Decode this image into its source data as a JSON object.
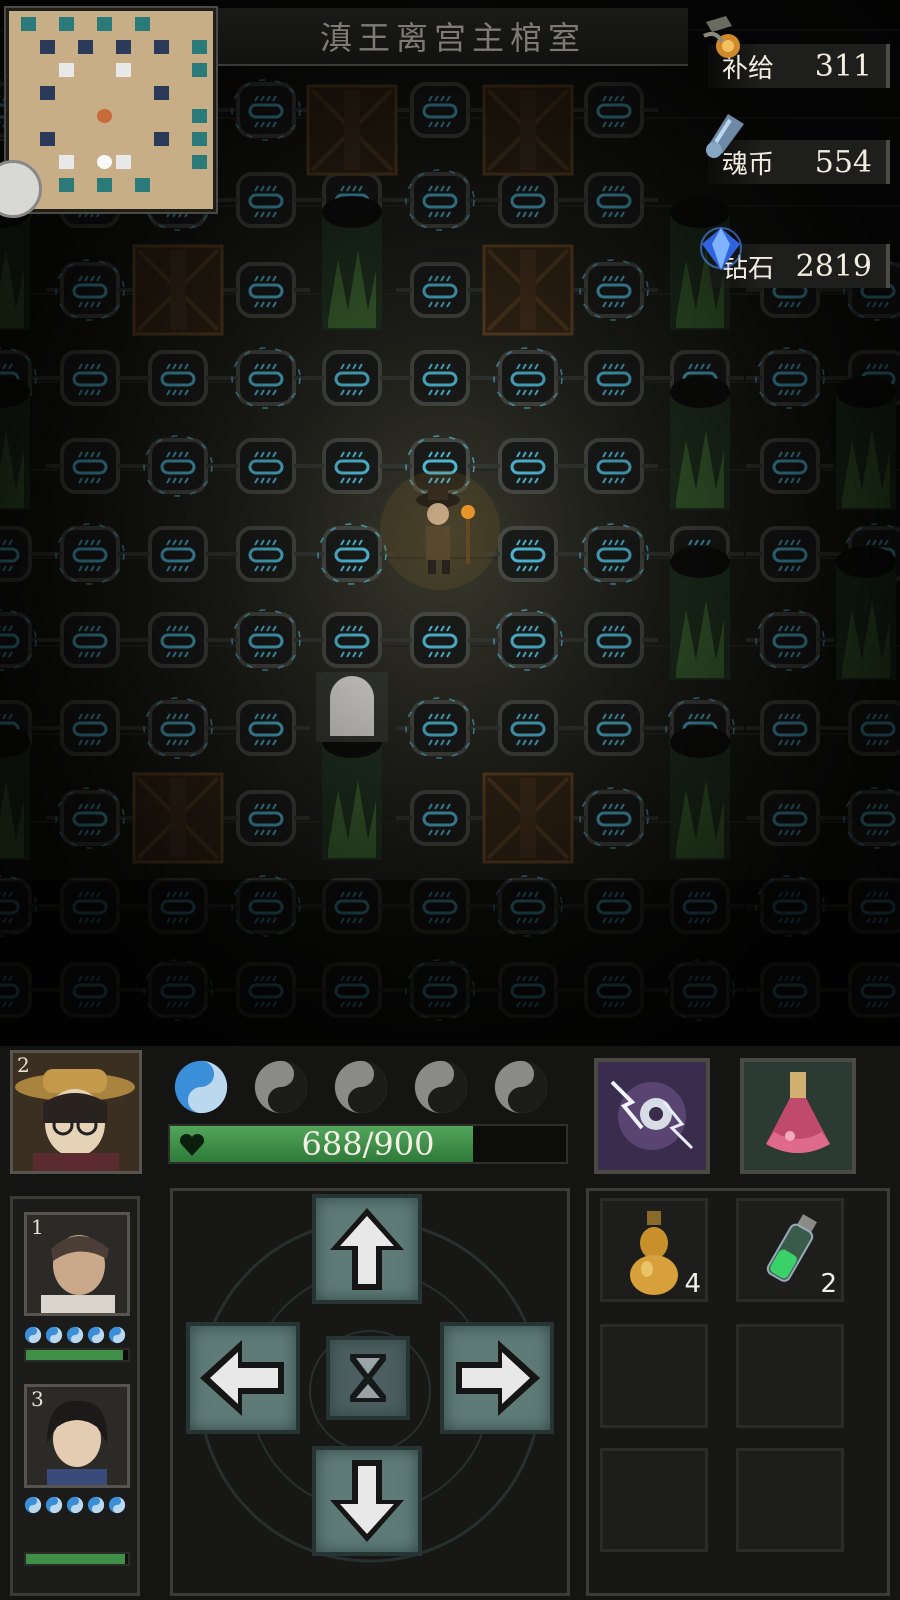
{
  "location_title": "滇王离宫主棺室",
  "currencies": [
    {
      "label": "补给",
      "value": "311",
      "icon": "supply-lantern-icon"
    },
    {
      "label": "魂币",
      "value": "554",
      "icon": "soul-coin-icon"
    },
    {
      "label": "钻石",
      "value": "2819",
      "icon": "diamond-icon"
    }
  ],
  "active_hero": {
    "slot": "2",
    "hp_text": "688/900",
    "hp_current": 688,
    "hp_max": 900,
    "yinyang_total": 5,
    "yinyang_filled": 1
  },
  "party": [
    {
      "slot": "1",
      "yinyang": 5,
      "hp_fraction": 0.95
    },
    {
      "slot": "3",
      "yinyang": 5,
      "hp_fraction": 0.97
    }
  ],
  "skills": [
    {
      "icon": "lightning-shield-skill-icon"
    },
    {
      "icon": "red-potion-flask-icon"
    }
  ],
  "inventory": [
    {
      "icon": "gourd-bottle-icon",
      "count": "4"
    },
    {
      "icon": "green-vial-icon",
      "count": "2"
    },
    {
      "icon": "",
      "count": ""
    },
    {
      "icon": "",
      "count": ""
    },
    {
      "icon": "",
      "count": ""
    },
    {
      "icon": "",
      "count": ""
    }
  ],
  "controls": {
    "up": "arrow-up-icon",
    "down": "arrow-down-icon",
    "left": "arrow-left-icon",
    "right": "arrow-right-icon",
    "wait": "hourglass-icon"
  },
  "colors": {
    "rune_glow": "#56c9e8",
    "hp_green": "#3f8f49",
    "tile_teal": "#5f7b78"
  }
}
